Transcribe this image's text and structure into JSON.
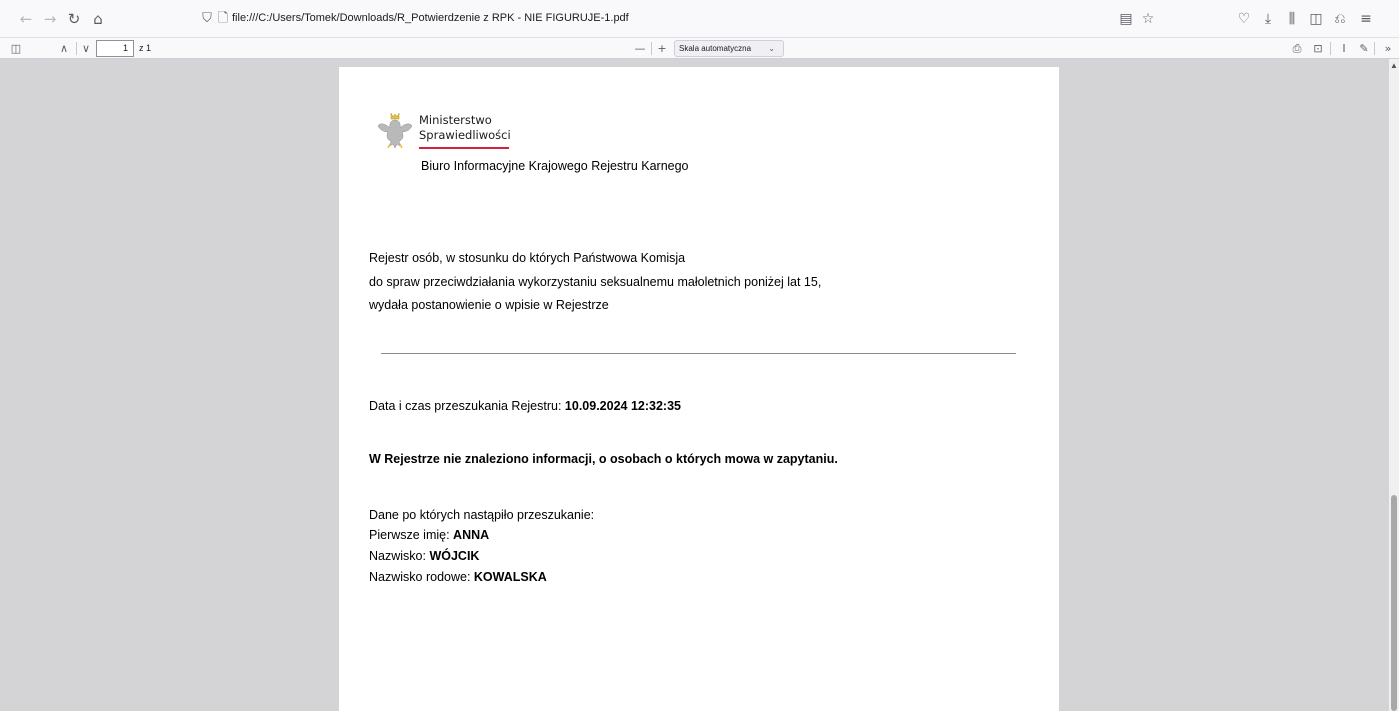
{
  "browser": {
    "url": "file:///C:/Users/Tomek/Downloads/R_Potwierdzenie z RPK - NIE FIGURUJE-1.pdf",
    "nav_icons": [
      "back-icon",
      "forward-icon",
      "reload-icon",
      "home-icon"
    ],
    "right_icons": [
      "reader-mode-icon",
      "bookmark-star-icon",
      "pocket-icon",
      "downloads-icon",
      "library-icon",
      "sidebar-icon",
      "extensions-icon",
      "menu-icon"
    ]
  },
  "pdf_toolbar": {
    "page_number": "1",
    "page_count_label": "z 1",
    "zoom_minus": "—",
    "zoom_plus": "+",
    "zoom_value": "Skala automatyczna"
  },
  "document": {
    "ministry_line1": "Ministerstwo",
    "ministry_line2": "Sprawiedliwości",
    "bureau": "Biuro Informacyjne Krajowego Rejestru Karnego",
    "register_desc": [
      "Rejestr osób, w stosunku do których Państwowa Komisja",
      "do spraw przeciwdziałania wykorzystaniu seksualnemu małoletnich poniżej lat 15,",
      "wydała postanowienie o wpisie w Rejestrze"
    ],
    "search_datetime_label": "Data i czas przeszukania Rejestru: ",
    "search_datetime_value": "10.09.2024 12:32:35",
    "result": "W Rejestrze nie znaleziono informacji, o osobach o których mowa w zapytaniu.",
    "search_data_header": "Dane po których nastąpiło przeszukanie:",
    "first_name_label": "Pierwsze imię: ",
    "first_name_value": "ANNA",
    "surname_label": "Nazwisko: ",
    "surname_value": "WÓJCIK",
    "family_name_label": "Nazwisko rodowe: ",
    "family_name_value": "KOWALSKA"
  },
  "colors": {
    "viewer_bg": "#d4d4d7",
    "accent_red": "#d4213d"
  }
}
